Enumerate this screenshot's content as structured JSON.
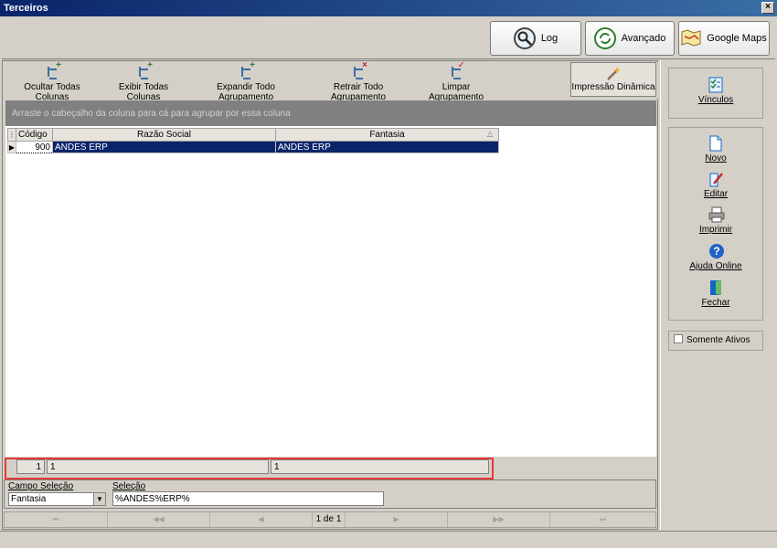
{
  "window": {
    "title": "Terceiros",
    "close_glyph": "×"
  },
  "topbar": {
    "log_label": "Log",
    "avancado_label": "Avançado",
    "maps_label": "Google Maps"
  },
  "toolbar": {
    "items": [
      {
        "label": "Ocultar Todas Colunas"
      },
      {
        "label": "Exibir Todas  Colunas"
      },
      {
        "label": "Expandir Todo Agrupamento"
      },
      {
        "label": "Retrair Todo Agrupamento"
      },
      {
        "label": "Limpar Agrupamento"
      }
    ],
    "impressao_label": "Impressão Dinâmica"
  },
  "grid": {
    "group_hint": "Arraste o cabeçalho da coluna para cá para agrupar por essa coluna",
    "columns": [
      "Código",
      "Razão Social",
      "Fantasia"
    ],
    "rows": [
      {
        "codigo": "900",
        "razao_social": "ANDES ERP",
        "fantasia": "ANDES ERP"
      }
    ],
    "footer": {
      "count_code": "1",
      "count_razao": "1",
      "count_fantasia": "1"
    }
  },
  "selection": {
    "campo_label": "Campo Seleção",
    "campo_value": "Fantasia",
    "selecao_label": "Seleção",
    "selecao_value": "%ANDES%ERP%"
  },
  "nav": {
    "page_text": "1 de 1"
  },
  "sidebar": {
    "vinculos_label": "Vínculos",
    "novo_label": "Novo",
    "editar_label": "Editar",
    "imprimir_label": "Imprimir",
    "ajuda_label": "Ajuda Online",
    "fechar_label": "Fechar",
    "somente_ativos_label": "Somente Ativos"
  },
  "colors": {
    "title_bar": "#0a246a",
    "selection": "#0a246a",
    "highlight_border": "#e53935"
  }
}
